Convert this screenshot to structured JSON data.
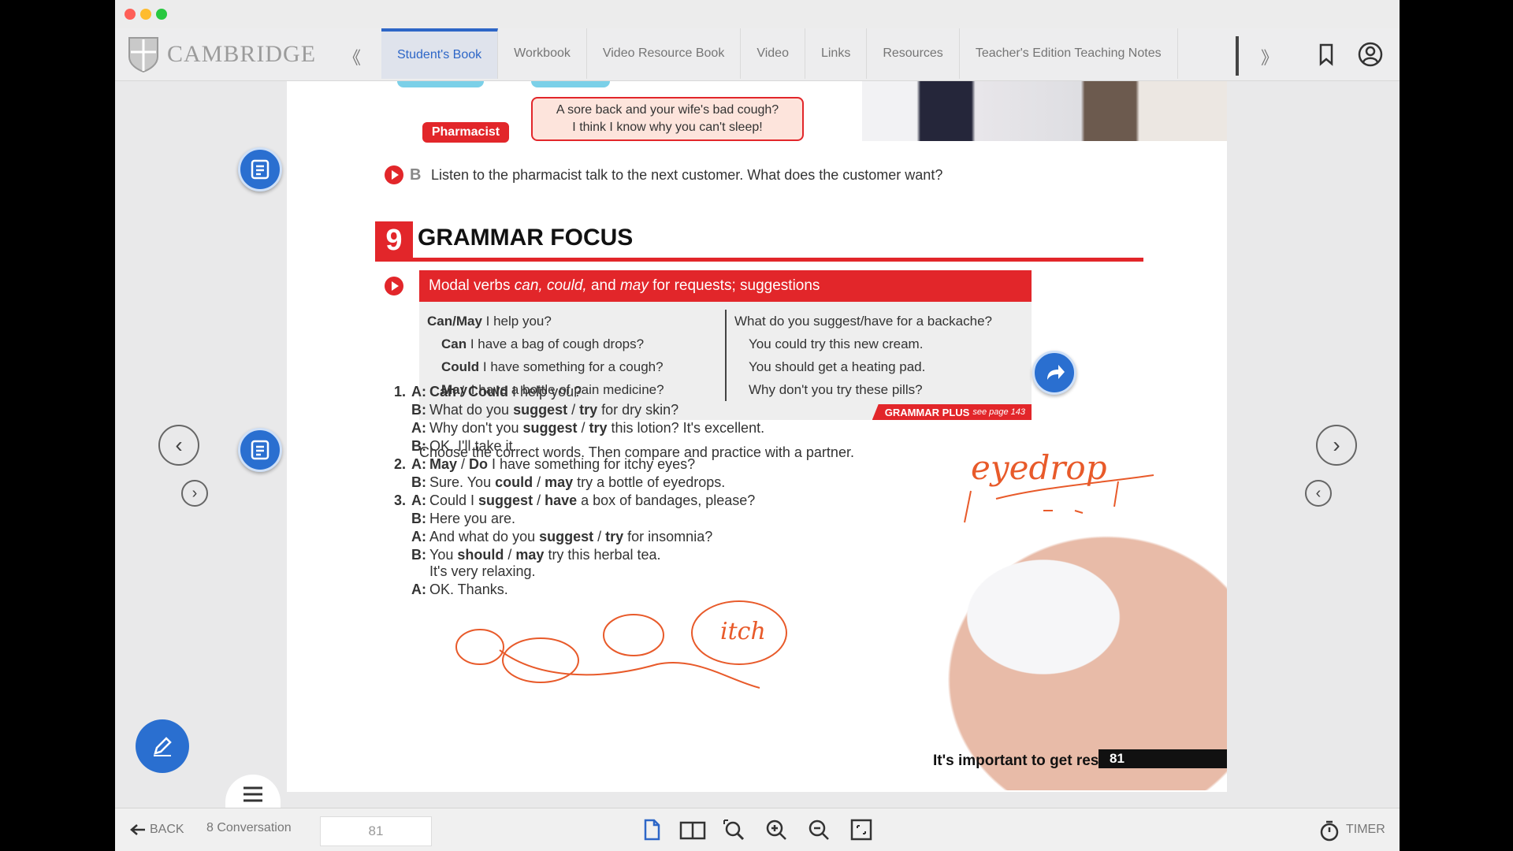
{
  "brand": {
    "name": "CAMBRIDGE"
  },
  "tabs": [
    {
      "label": "Student's Book",
      "active": true
    },
    {
      "label": "Workbook"
    },
    {
      "label": "Video Resource Book"
    },
    {
      "label": "Video"
    },
    {
      "label": "Links"
    },
    {
      "label": "Resources"
    },
    {
      "label": "Teacher's Edition Teaching Notes"
    }
  ],
  "nav": {
    "prev_glyph": "《",
    "next_glyph": "》"
  },
  "page": {
    "pharmacist_label": "Pharmacist",
    "speech_line1": "A sore back and your wife's bad cough?",
    "speech_line2": "I think I know why you can't sleep!",
    "task_b_letter": "B",
    "task_b_text": "Listen to the pharmacist talk to the next customer. What does the customer want?",
    "section_number": "9",
    "section_title": "GRAMMAR FOCUS",
    "grammar": {
      "heading_pre": "Modal verbs ",
      "heading_em": "can, could,",
      "heading_mid": " and ",
      "heading_em2": "may",
      "heading_post": " for requests; suggestions",
      "left": [
        {
          "bold": "Can/May",
          "rest": " I help you?"
        },
        {
          "bold": "Can",
          "rest": " I have a bag of cough drops?"
        },
        {
          "bold": "Could",
          "rest": " I have something for a cough?"
        },
        {
          "bold": "May",
          "rest": " I have a bottle of pain medicine?"
        }
      ],
      "right": [
        "What do you suggest/have for a backache?",
        "You could try this new cream.",
        "You should get a heating pad.",
        "Why don't you try these pills?"
      ],
      "plus_label": "GRAMMAR PLUS",
      "plus_ref": "see page 143"
    },
    "exercise_intro": "Choose the correct words. Then compare and practice with a partner.",
    "exercise": [
      {
        "num": "1.",
        "spk": "A:",
        "parts": [
          [
            "b",
            "Can"
          ],
          [
            "n",
            " / "
          ],
          [
            "b",
            "Could"
          ],
          [
            "n",
            " I help you?"
          ]
        ]
      },
      {
        "num": "",
        "spk": "B:",
        "parts": [
          [
            "n",
            "What do you "
          ],
          [
            "b",
            "suggest"
          ],
          [
            "n",
            " / "
          ],
          [
            "b",
            "try"
          ],
          [
            "n",
            " for dry skin?"
          ]
        ]
      },
      {
        "num": "",
        "spk": "A:",
        "parts": [
          [
            "n",
            "Why don't you "
          ],
          [
            "b",
            "suggest"
          ],
          [
            "n",
            " / "
          ],
          [
            "b",
            "try"
          ],
          [
            "n",
            " this lotion? It's excellent."
          ]
        ]
      },
      {
        "num": "",
        "spk": "B:",
        "parts": [
          [
            "n",
            "OK. I'll take it."
          ]
        ]
      },
      {
        "num": "2.",
        "spk": "A:",
        "parts": [
          [
            "b",
            "May"
          ],
          [
            "n",
            " / "
          ],
          [
            "b",
            "Do"
          ],
          [
            "n",
            " I have something for itchy eyes?"
          ]
        ]
      },
      {
        "num": "",
        "spk": "B:",
        "parts": [
          [
            "n",
            "Sure. You "
          ],
          [
            "b",
            "could"
          ],
          [
            "n",
            " / "
          ],
          [
            "b",
            "may"
          ],
          [
            "n",
            " try a bottle of eyedrops."
          ]
        ]
      },
      {
        "num": "3.",
        "spk": "A:",
        "parts": [
          [
            "n",
            "Could I "
          ],
          [
            "b",
            "suggest"
          ],
          [
            "n",
            " / "
          ],
          [
            "b",
            "have"
          ],
          [
            "n",
            " a box of bandages, please?"
          ]
        ]
      },
      {
        "num": "",
        "spk": "B:",
        "parts": [
          [
            "n",
            "Here you are."
          ]
        ]
      },
      {
        "num": "",
        "spk": "A:",
        "parts": [
          [
            "n",
            "And what do you "
          ],
          [
            "b",
            "suggest"
          ],
          [
            "n",
            " / "
          ],
          [
            "b",
            "try"
          ],
          [
            "n",
            " for insomnia?"
          ]
        ]
      },
      {
        "num": "",
        "spk": "B:",
        "parts": [
          [
            "n",
            "You "
          ],
          [
            "b",
            "should"
          ],
          [
            "n",
            " / "
          ],
          [
            "b",
            "may"
          ],
          [
            "n",
            " try this herbal tea."
          ]
        ]
      },
      {
        "num": "",
        "spk": "",
        "parts": [
          [
            "n",
            "It's very relaxing."
          ]
        ]
      },
      {
        "num": "",
        "spk": "A:",
        "parts": [
          [
            "n",
            "OK. Thanks."
          ]
        ]
      }
    ],
    "annotation": {
      "word1": "eyedrop",
      "word2": "itch",
      "color": "#e85a2a"
    },
    "footer_text": "It's important to get rest.",
    "page_number": "81"
  },
  "bottom": {
    "back_label": "BACK",
    "unit_label": "8 Conversation",
    "page_value": "81",
    "timer_label": "TIMER"
  },
  "colors": {
    "accent": "#2d66c7",
    "red": "#e2262a",
    "blue_btn": "#2a6fd0"
  }
}
